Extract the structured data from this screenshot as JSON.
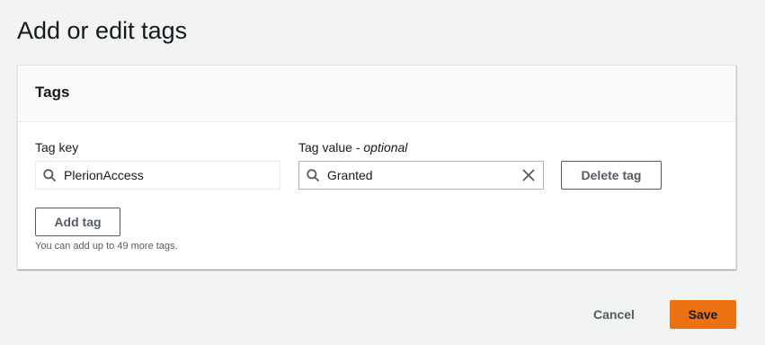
{
  "page": {
    "title": "Add or edit tags"
  },
  "panel": {
    "title": "Tags",
    "tag_key_label": "Tag key",
    "tag_value_label_main": "Tag value - ",
    "tag_value_label_optional": "optional",
    "rows": [
      {
        "key": "PlerionAccess",
        "value": "Granted",
        "delete_label": "Delete tag"
      }
    ],
    "add_tag_label": "Add tag",
    "hint": "You can add up to 49 more tags."
  },
  "footer": {
    "cancel_label": "Cancel",
    "save_label": "Save"
  },
  "colors": {
    "accent": "#ec7211",
    "background": "#f2f3f3",
    "panel_header": "#fafafa"
  },
  "icons": {
    "search": "search-icon",
    "clear": "close-icon"
  }
}
